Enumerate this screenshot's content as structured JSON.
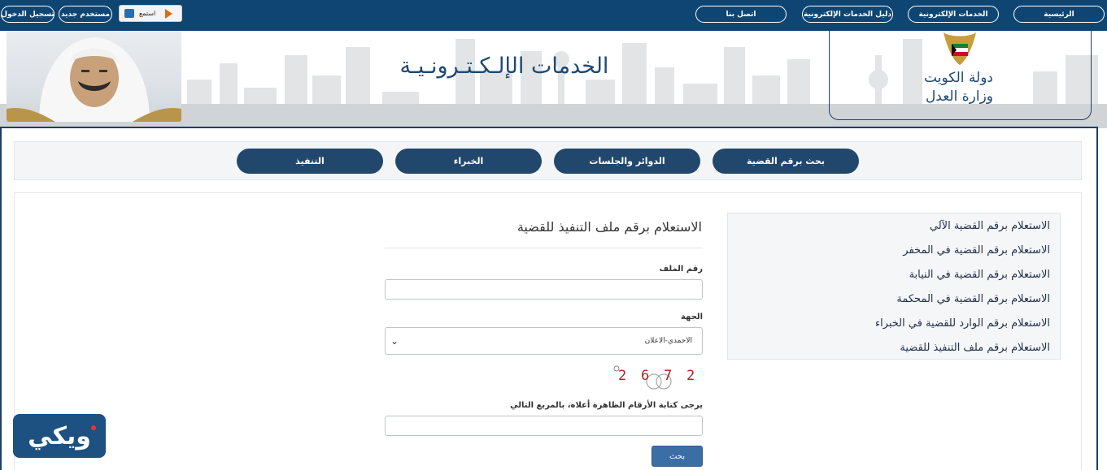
{
  "topbar": {
    "login": "تسجيل الدخول",
    "new_user": "مستخدم جديد",
    "listen": "استمع",
    "nav": [
      {
        "label": "الرئيسية"
      },
      {
        "label": "الخدمات الإلكترونية"
      },
      {
        "label": "دليل الخدمات الإلكترونية"
      },
      {
        "label": "اتصل بنا"
      }
    ]
  },
  "header": {
    "site_title": "الخدمات الإلـكـتـرونـيـة",
    "logo_line1": "دولة الكويت",
    "logo_line2": "وزارة العدل"
  },
  "tabs": [
    {
      "label": "بحث برقم القضية"
    },
    {
      "label": "الدوائر والجلسات"
    },
    {
      "label": "الخبراء"
    },
    {
      "label": "التنفيذ"
    }
  ],
  "side_menu": [
    {
      "label": "الاستعلام برقم القضية الآلي"
    },
    {
      "label": "الاستعلام برقم القضية في المخفر"
    },
    {
      "label": "الاستعلام برقم القضية في النيابة"
    },
    {
      "label": "الاستعلام برقم القضية في المحكمة"
    },
    {
      "label": "الاستعلام برقم الوارد للقضية في الخبراء"
    },
    {
      "label": "الاستعلام برقم ملف التنفيذ للقضية"
    }
  ],
  "form": {
    "title": "الاستعلام برقم ملف التنفيذ للقضية",
    "file_number_label": "رقم الملف",
    "file_number_value": "",
    "entity_label": "الجهة",
    "entity_selected": "الاحمدي-الاعلان",
    "captcha_digits": [
      "2",
      "6",
      "7",
      "2"
    ],
    "captcha_label": "يرجى كتابة الأرقام الظاهرة أعلاه، بالمربع التالي",
    "captcha_value": "",
    "search_button": "بحث"
  },
  "watermark": {
    "text": "ويكي"
  },
  "colors": {
    "topbar": "#0f4573",
    "tab": "#21476d",
    "button": "#3a6ea5",
    "captcha": "#b32020"
  }
}
